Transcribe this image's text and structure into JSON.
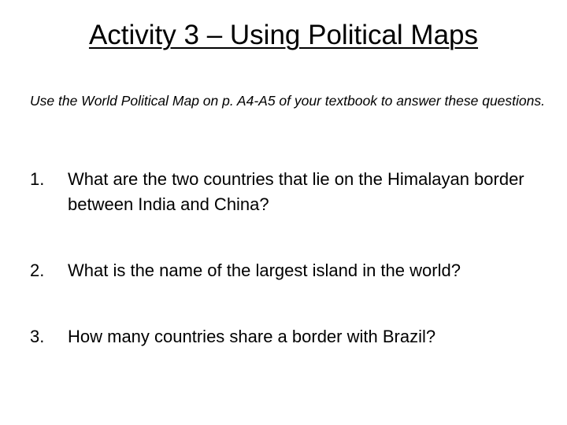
{
  "title": "Activity 3 – Using Political Maps",
  "instructions": "Use the World Political Map on p. A4-A5 of your textbook to answer these questions.",
  "questions": [
    {
      "number": "1.",
      "text": "What are the two countries that lie on the Himalayan border between India and China?"
    },
    {
      "number": "2.",
      "text": "What is the name of the largest island in the world?"
    },
    {
      "number": "3.",
      "text": "How many countries share a border with Brazil?"
    }
  ]
}
